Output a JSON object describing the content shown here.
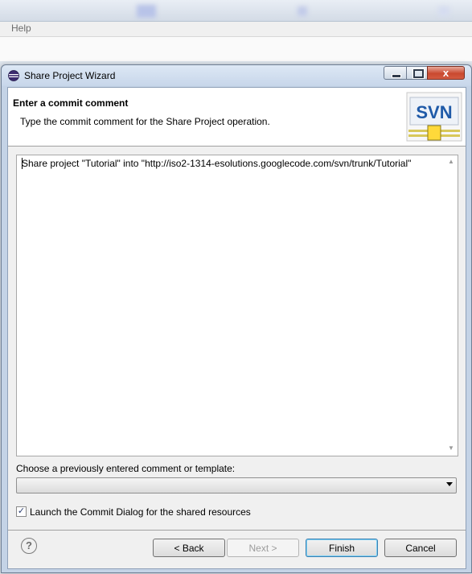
{
  "menubar": {
    "help_label": "Help"
  },
  "dialog": {
    "title": "Share Project Wizard",
    "close_glyph": "x",
    "header": {
      "title": "Enter a commit comment",
      "description": "Type the commit comment for the Share Project operation.",
      "logo_text": "SVN"
    },
    "comment": {
      "value": "Share project \"Tutorial\" into \"http://iso2-1314-esolutions.googlecode.com/svn/trunk/Tutorial\""
    },
    "template": {
      "label": "Choose a previously entered comment or template:",
      "selected": ""
    },
    "launch_commit": {
      "label": "Launch the Commit Dialog for the shared resources",
      "checked": true,
      "check_glyph": "✓"
    },
    "buttons": {
      "back": "< Back",
      "next": "Next >",
      "finish": "Finish",
      "cancel": "Cancel"
    },
    "help_glyph": "?"
  },
  "colors": {
    "accent_focus": "#3c7fb1",
    "logo_blue": "#1f5aa8",
    "logo_yellow": "#ffd93a"
  }
}
